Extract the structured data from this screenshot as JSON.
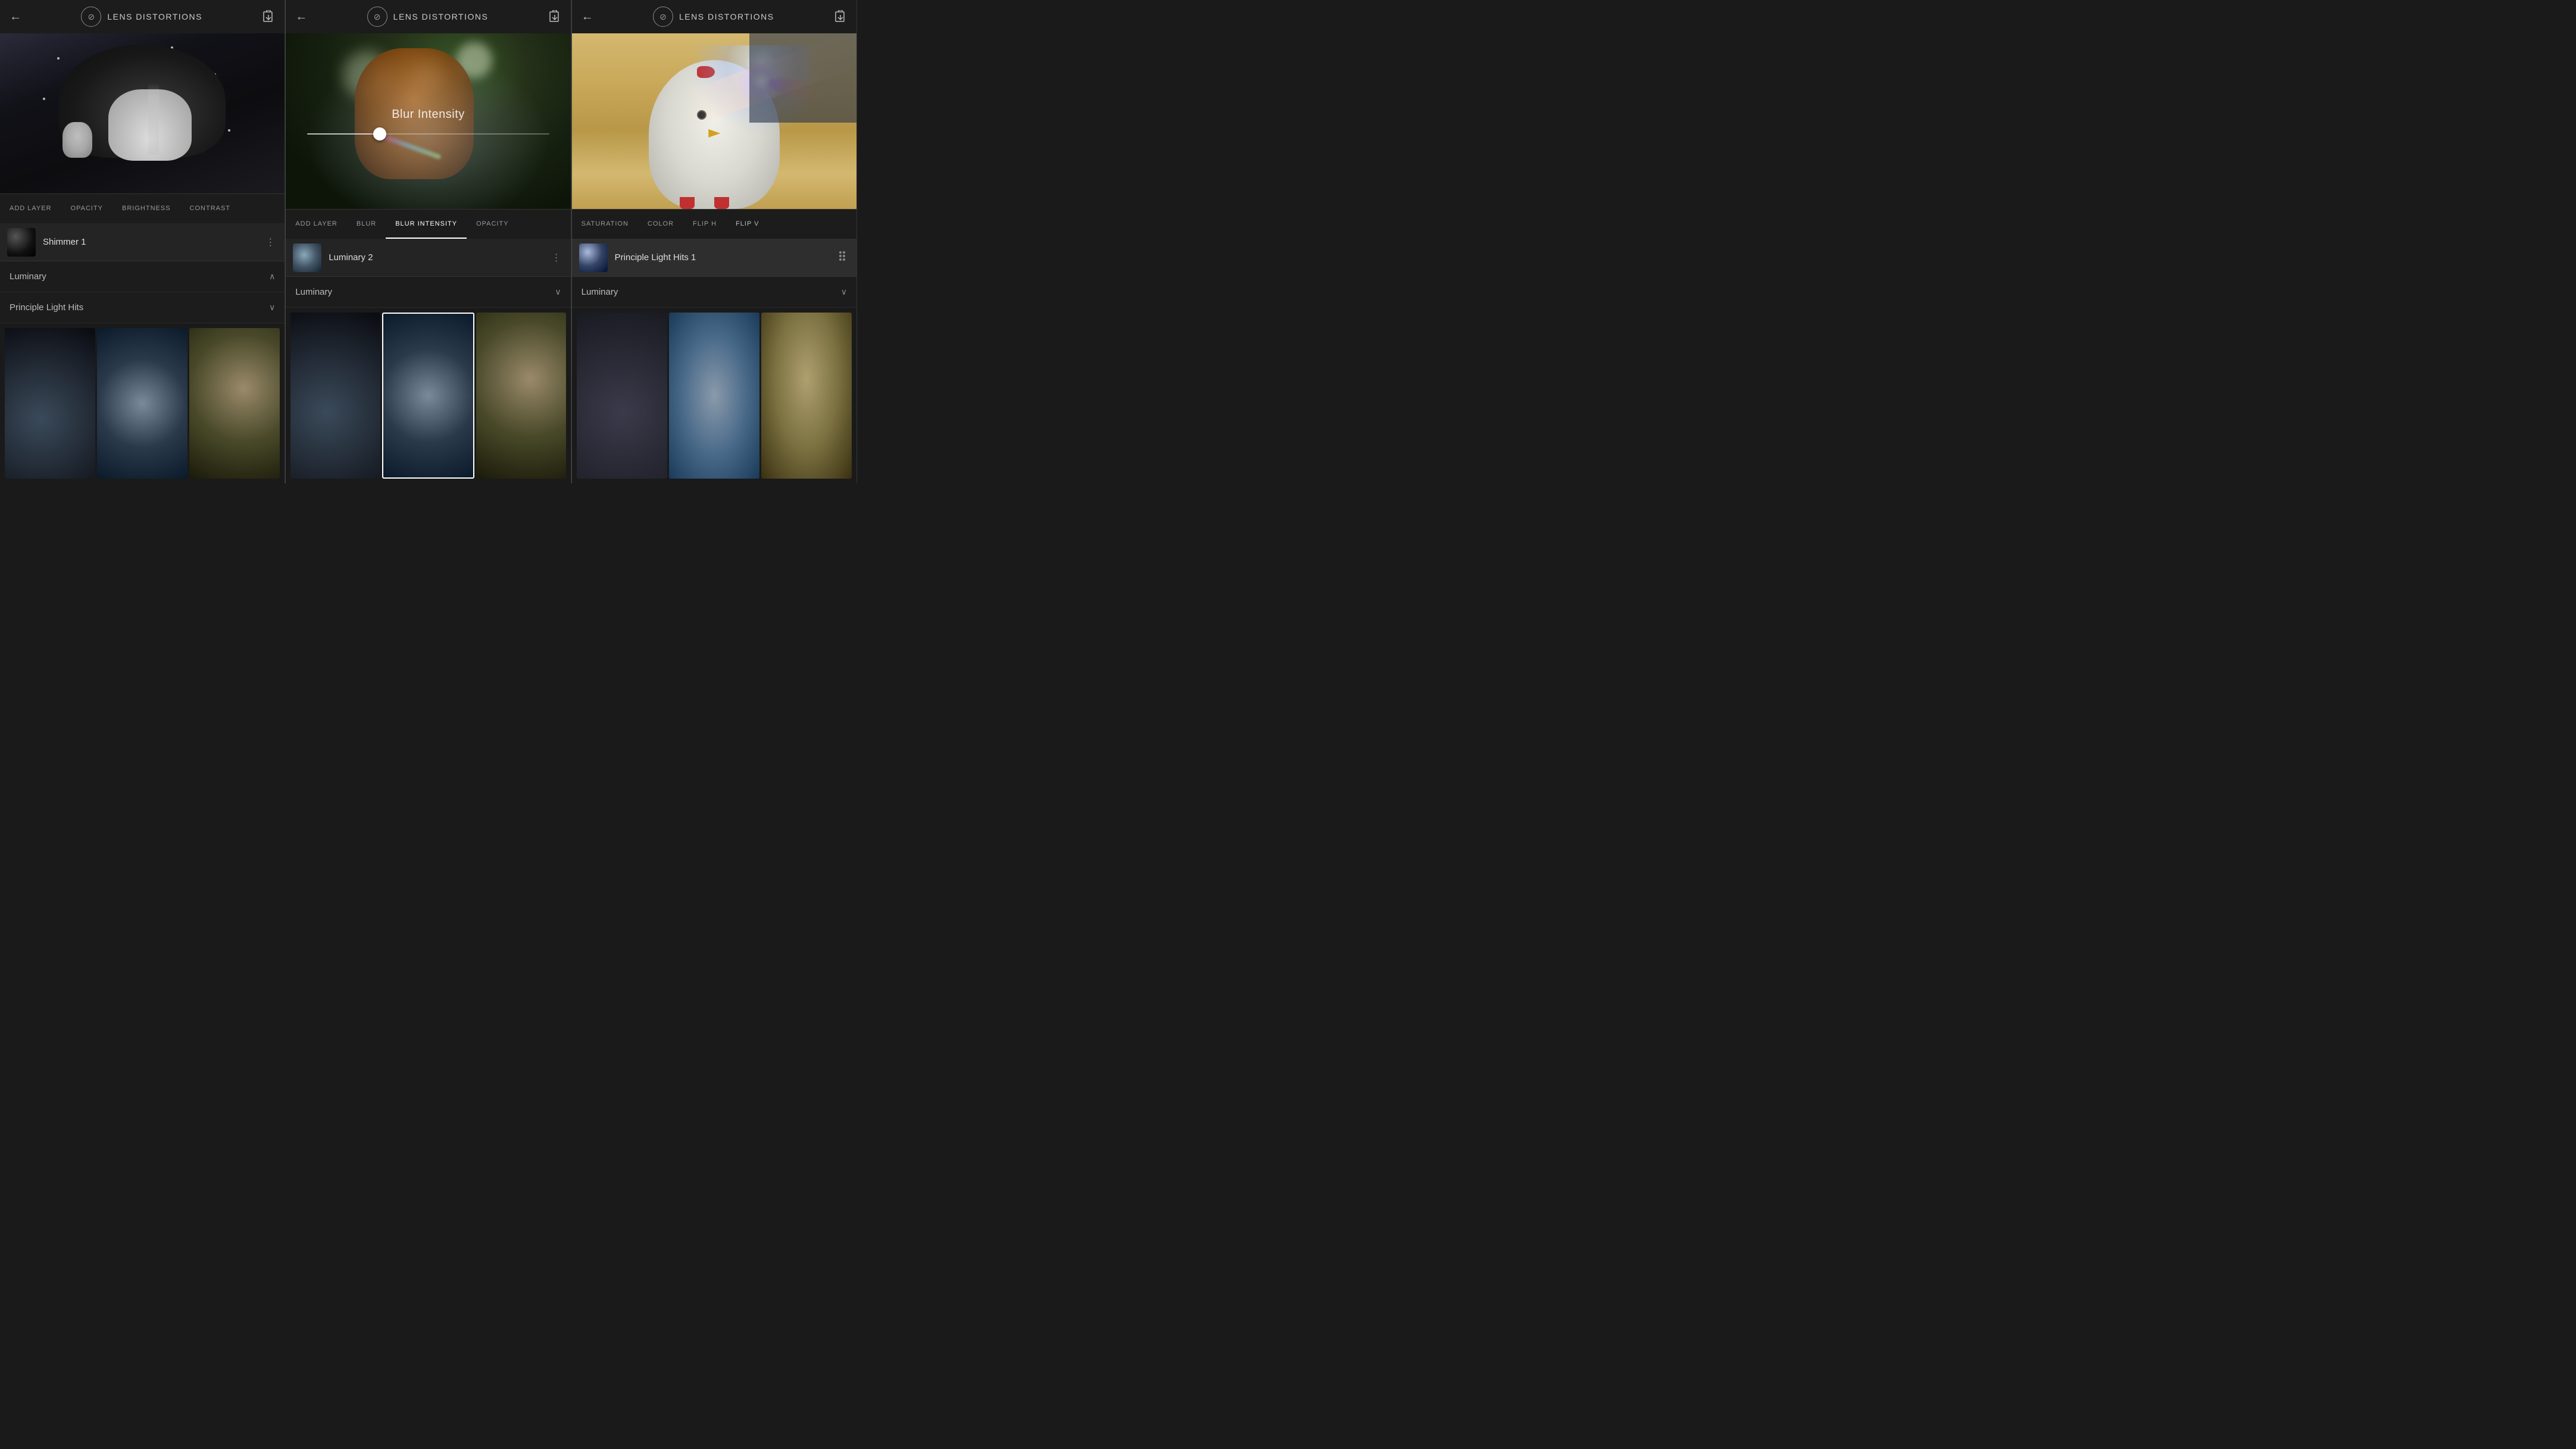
{
  "app": {
    "name": "LENS DISTORTIONS"
  },
  "panel1": {
    "header": {
      "back_label": "←",
      "title": "LENS DISTORTIONS",
      "export_label": "⇥"
    },
    "toolbar": {
      "items": [
        "ADD LAYER",
        "OPACITY",
        "BRIGHTNESS",
        "CONTRAST"
      ]
    },
    "layer": {
      "name": "Shimmer 1",
      "dots": "⋮"
    },
    "accordion1": {
      "label": "Luminary",
      "chevron": "∧"
    },
    "accordion2": {
      "label": "Principle Light Hits",
      "chevron": "∨"
    }
  },
  "panel2": {
    "header": {
      "back_label": "←",
      "title": "LENS DISTORTIONS",
      "export_label": "⇥"
    },
    "toolbar": {
      "items": [
        "ADD LAYER",
        "BLUR",
        "BLUR INTENSITY",
        "OPACITY"
      ]
    },
    "blur_control": {
      "label": "Blur Intensity"
    },
    "layer": {
      "name": "Luminary 2",
      "dots": "⋮"
    },
    "accordion1": {
      "label": "Luminary",
      "chevron": "∨"
    },
    "gallery_selected": 1
  },
  "panel3": {
    "header": {
      "back_label": "←",
      "title": "LENS DISTORTIONS",
      "export_label": "⇥"
    },
    "toolbar": {
      "items": [
        "SATURATION",
        "COLOR",
        "FLIP H",
        "FLIP V"
      ]
    },
    "layer": {
      "name": "Principle Light Hits 1",
      "dots": "⋮"
    },
    "accordion1": {
      "label": "Luminary",
      "chevron": "∨"
    },
    "gallery": {
      "thumbs": [
        "thumb1",
        "thumb2",
        "thumb3"
      ]
    }
  }
}
